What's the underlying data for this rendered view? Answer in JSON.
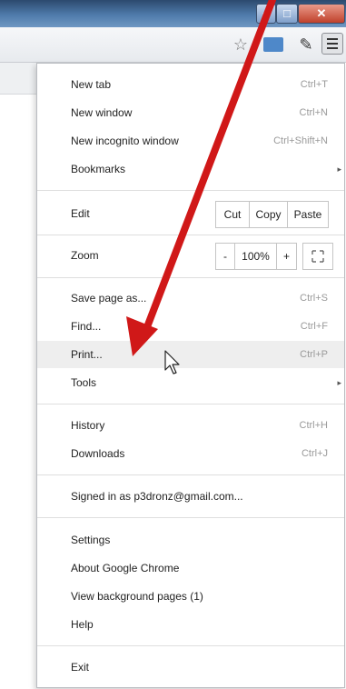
{
  "window": {
    "minimize_glyph": "−",
    "maximize_glyph": "□",
    "close_glyph": "✕"
  },
  "toolbar": {
    "star_glyph": "☆",
    "pen_glyph": "✎"
  },
  "menu": {
    "new_tab": {
      "label": "New tab",
      "shortcut": "Ctrl+T"
    },
    "new_window": {
      "label": "New window",
      "shortcut": "Ctrl+N"
    },
    "new_incognito": {
      "label": "New incognito window",
      "shortcut": "Ctrl+Shift+N"
    },
    "bookmarks": {
      "label": "Bookmarks",
      "arrow": "▸"
    },
    "edit": {
      "label": "Edit",
      "cut": "Cut",
      "copy": "Copy",
      "paste": "Paste"
    },
    "zoom": {
      "label": "Zoom",
      "minus": "-",
      "value": "100%",
      "plus": "+"
    },
    "save_page": {
      "label": "Save page as...",
      "shortcut": "Ctrl+S"
    },
    "find": {
      "label": "Find...",
      "shortcut": "Ctrl+F"
    },
    "print": {
      "label": "Print...",
      "shortcut": "Ctrl+P"
    },
    "tools": {
      "label": "Tools",
      "arrow": "▸"
    },
    "history": {
      "label": "History",
      "shortcut": "Ctrl+H"
    },
    "downloads": {
      "label": "Downloads",
      "shortcut": "Ctrl+J"
    },
    "signed_in": {
      "label": "Signed in as p3dronz@gmail.com..."
    },
    "settings": {
      "label": "Settings"
    },
    "about": {
      "label": "About Google Chrome"
    },
    "background_pages": {
      "label": "View background pages (1)"
    },
    "help": {
      "label": "Help"
    },
    "exit": {
      "label": "Exit"
    }
  },
  "colors": {
    "annotation_arrow": "#d01818",
    "highlight": "#eeeeee"
  }
}
